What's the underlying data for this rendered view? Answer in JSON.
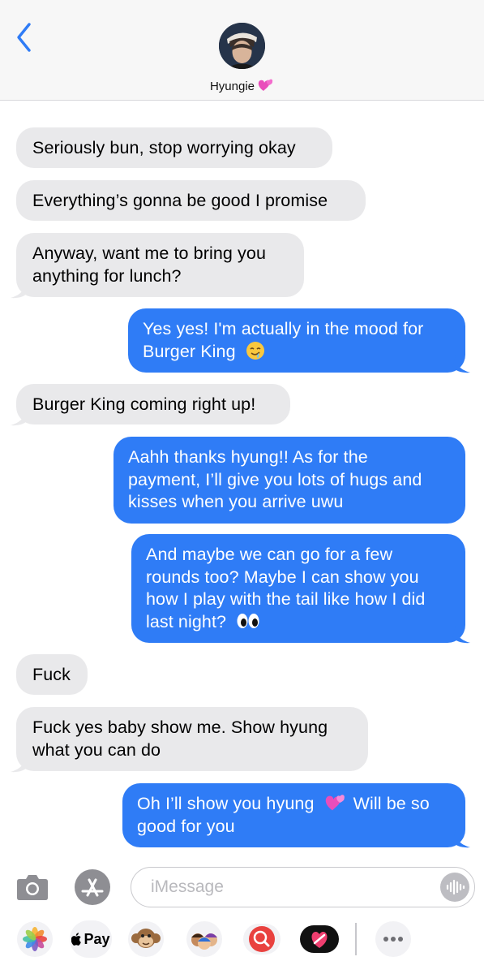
{
  "header": {
    "contact_name": "Hyungie",
    "back_icon": "chevron-left-icon",
    "accent_color": "#2f7cf6"
  },
  "messages": [
    {
      "side": "received",
      "lines": [
        "Seriously bun, stop worrying okay"
      ]
    },
    {
      "side": "received",
      "lines": [
        "Everything’s gonna be good I promise"
      ]
    },
    {
      "side": "received",
      "lines": [
        "Anyway, want me to bring you",
        "anything for lunch?"
      ]
    },
    {
      "side": "sent",
      "lines": [
        "Yes yes! I'm actually in the mood for",
        "Burger King"
      ]
    },
    {
      "side": "received",
      "lines": [
        "Burger King coming right up!"
      ]
    },
    {
      "side": "sent",
      "lines": [
        "Aahh thanks hyung!! As for the",
        "payment, I’ll give you lots of hugs and",
        "kisses when you arrive uwu"
      ]
    },
    {
      "side": "sent",
      "lines": [
        "And maybe we can go for a few",
        "rounds too? Maybe I can show you",
        "how I play with the tail like how I did",
        "last night?"
      ]
    },
    {
      "side": "received",
      "lines": [
        "Fuck"
      ]
    },
    {
      "side": "received",
      "lines": [
        "Fuck yes baby show me. Show hyung",
        "what you can do"
      ]
    },
    {
      "side": "sent",
      "lines": [
        "Oh I’ll show you hyung",
        "Will be so",
        "good for you"
      ]
    }
  ],
  "input": {
    "placeholder": "iMessage",
    "camera_icon": "camera-icon",
    "appstore_icon": "app-store-icon",
    "audio_icon": "waveform-icon"
  },
  "app_tray": {
    "pay_label": "Pay",
    "items": [
      "photos-icon",
      "apple-pay-icon",
      "monkey-memoji-icon",
      "memoji-icon",
      "search-images-icon",
      "digital-touch-icon",
      "more-icon"
    ]
  },
  "colors": {
    "received_bubble": "#e9e9eb",
    "sent_bubble": "#2f7cf6",
    "header_bg": "#f7f7f7"
  }
}
